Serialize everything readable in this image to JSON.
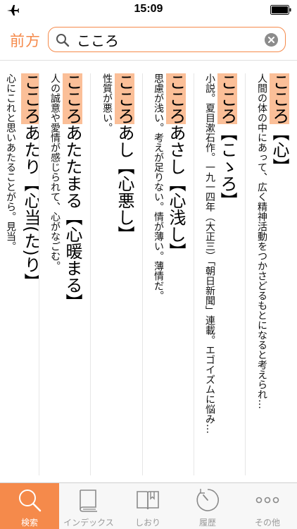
{
  "status_bar": {
    "time": "15:09"
  },
  "header": {
    "back_label": "前方",
    "search_value": "こころ",
    "accent_color": "#f58a4b"
  },
  "results": [
    {
      "kana": "こころ",
      "kanji": "【心】",
      "body": "人間の体の中にあって、広く精神活動をつかさどるもとになると考えられ…"
    },
    {
      "kana": "こころ",
      "kanji": "【こゝろ】",
      "body": "小説。夏目漱石作。一九一四年（大正三）「朝日新聞」連載。エゴイズムに悩み…"
    },
    {
      "kana": "こころ",
      "kanji": "あさし【心浅し】",
      "body": "思慮が浅い。考えが足りない。情が薄い。薄情だ。"
    },
    {
      "kana": "こころ",
      "kanji": "あし【心悪し】",
      "body": "性質が悪い。"
    },
    {
      "kana": "こころ",
      "kanji": "あたたまる【心暖まる】",
      "body": "人の誠意や愛情が感じられて、心がなごむ。"
    },
    {
      "kana": "こころ",
      "kanji": "あたり【心当(た)り】",
      "body": "心にこれと思いあたることがら。見当。"
    }
  ],
  "tab_bar": {
    "tabs": [
      {
        "label": "検索",
        "icon": "magnifier-icon",
        "active": true
      },
      {
        "label": "インデックス",
        "icon": "book-icon",
        "active": false
      },
      {
        "label": "しおり",
        "icon": "bookmark-book-icon",
        "active": false
      },
      {
        "label": "履歴",
        "icon": "history-clock-icon",
        "active": false
      },
      {
        "label": "その他",
        "icon": "more-dots-icon",
        "active": false
      }
    ]
  }
}
